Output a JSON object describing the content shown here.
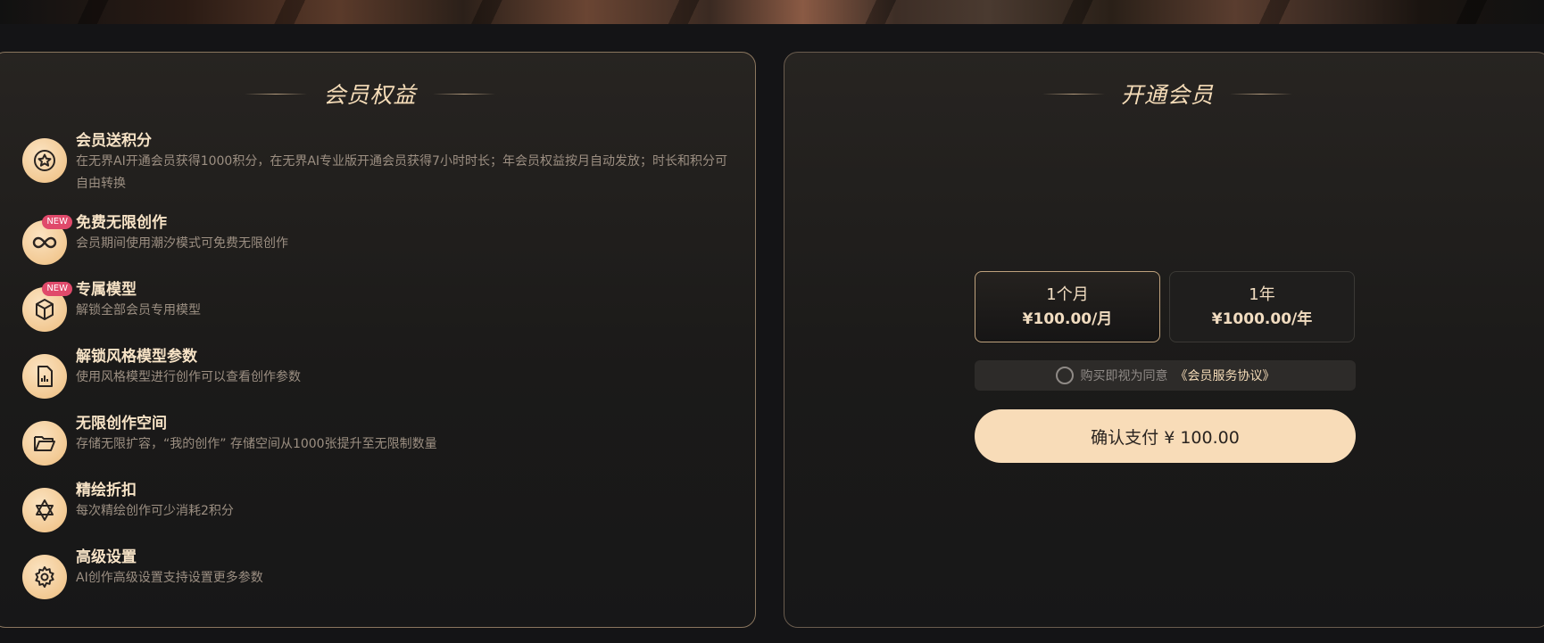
{
  "benefits_panel": {
    "title": "会员权益",
    "items": [
      {
        "title": "会员送积分",
        "desc": "在无界AI开通会员获得1000积分，在无界AI专业版开通会员获得7小时时长；年会员权益按月自动发放；时长和积分可自由转换",
        "icon": "star-badge-icon",
        "badge": ""
      },
      {
        "title": "免费无限创作",
        "desc": "会员期间使用潮汐模式可免费无限创作",
        "icon": "infinity-icon",
        "badge": "NEW"
      },
      {
        "title": "专属模型",
        "desc": "解锁全部会员专用模型",
        "icon": "cube-icon",
        "badge": "NEW"
      },
      {
        "title": "解锁风格模型参数",
        "desc": "使用风格模型进行创作可以查看创作参数",
        "icon": "chart-document-icon",
        "badge": ""
      },
      {
        "title": "无限创作空间",
        "desc": "存储无限扩容，“我的创作” 存储空间从1000张提升至无限制数量",
        "icon": "folder-open-icon",
        "badge": ""
      },
      {
        "title": "精绘折扣",
        "desc": "每次精绘创作可少消耗2积分",
        "icon": "star-of-david-icon",
        "badge": ""
      },
      {
        "title": "高级设置",
        "desc": "AI创作高级设置支持设置更多参数",
        "icon": "gear-icon",
        "badge": ""
      }
    ]
  },
  "purchase_panel": {
    "title": "开通会员",
    "plans": [
      {
        "period": "1个月",
        "price": "¥100.00/月",
        "selected": true
      },
      {
        "period": "1年",
        "price": "¥1000.00/年",
        "selected": false
      }
    ],
    "agreement": {
      "text": "购买即视为同意",
      "link": "《会员服务协议》"
    },
    "pay_button": "确认支付 ¥ 100.00"
  },
  "colors": {
    "accent": "#f8dcb8",
    "badge": "#e04a6b",
    "background": "#141416"
  }
}
